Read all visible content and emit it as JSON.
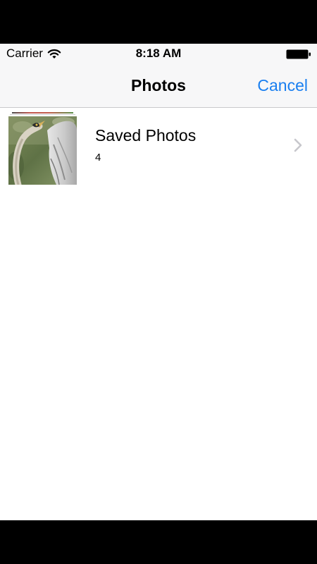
{
  "status_bar": {
    "carrier": "Carrier",
    "time": "8:18 AM",
    "icons": [
      "wifi-icon",
      "battery-icon"
    ]
  },
  "nav_bar": {
    "title": "Photos",
    "cancel_label": "Cancel"
  },
  "albums": [
    {
      "title": "Saved Photos",
      "count": "4",
      "thumbnail": "heron-photo"
    }
  ],
  "colors": {
    "accent": "#1a7ff0",
    "nav_background": "#f7f7f8",
    "chevron": "#c7c7cc"
  }
}
